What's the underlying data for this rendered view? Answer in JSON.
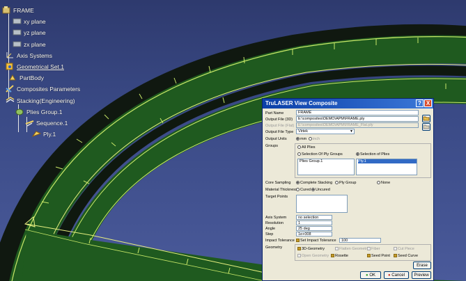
{
  "tree": {
    "items": [
      {
        "label": "FRAME"
      },
      {
        "label": "xy plane"
      },
      {
        "label": "yz plane"
      },
      {
        "label": "zx plane"
      },
      {
        "label": "Axis Systems"
      },
      {
        "label": "Geometrical Set.1"
      },
      {
        "label": "PartBody"
      },
      {
        "label": "Composites Parameters"
      },
      {
        "label": "Stacking(Engineering)"
      },
      {
        "label": "Plies Group.1"
      },
      {
        "label": "Sequence.1"
      },
      {
        "label": "Ply.1"
      }
    ]
  },
  "dialog": {
    "title": "TruLASER View Composite",
    "part_name_label": "Part Name",
    "part_name_value": "FRAME",
    "output_file_3d_label": "Output File (3D)",
    "output_file_3d_value": "E:\\composites\\DEMO\\APM\\FRAME.ply",
    "output_file_flat_label": "Output File (Flat)",
    "output_file_flat_value": "E:\\composites\\DEMO\\APM\\FRAME_Flat.ply",
    "output_file_type_label": "Output File Type",
    "output_file_type_value": "Virtek",
    "output_units_label": "Output Units",
    "units_mm": "mm",
    "units_inch": "inch",
    "groups_label": "Groups",
    "all_plies": "All Plies",
    "selection_ply_groups": "Selection Of Ply Groups",
    "selection_of_plies": "Selection of Plies",
    "group_list": [
      "Plies Group.1"
    ],
    "ply_list": [
      "Ply.1"
    ],
    "core_sampling_label": "Core Sampling",
    "complete_stacking": "Complete Stacking",
    "ply_group": "Ply Group",
    "none": "None",
    "material_thickness_label": "Material Thickness",
    "cured": "Cured",
    "uncured": "Uncured",
    "target_points_label": "Target Points",
    "axis_system_label": "Axis System",
    "axis_system_value": "no selection",
    "resolution_label": "Resolution",
    "resolution_value": "1",
    "angle_label": "Angle",
    "angle_value": "25 deg",
    "step_label": "Step",
    "step_value": "1e+008",
    "impact_tolerance_label": "Impact Tolerance",
    "set_impact_tolerance": "Set Impact Tolerance",
    "impact_tolerance_value": "100",
    "geometry_label": "Geometry",
    "geo_3d": "3D-Geometry",
    "geo_flatten": "Flatten Geometry",
    "geo_fiber": "Fiber",
    "geo_cut_piece": "Cut Piece",
    "geo_open": "Open Geometry",
    "geo_rosette": "Rosette",
    "geo_seed_point": "Seed Point",
    "geo_seed_curve": "Seed Curve",
    "erase": "Erase",
    "ok": "OK",
    "cancel": "Cancel",
    "preview": "Preview",
    "help_glyph": "?",
    "close_glyph": "X"
  },
  "colors": {
    "band": "#1f5a1f",
    "band_edge": "#c8e868",
    "background": "#3a4a86",
    "title_bar": "#0a3fa8"
  }
}
